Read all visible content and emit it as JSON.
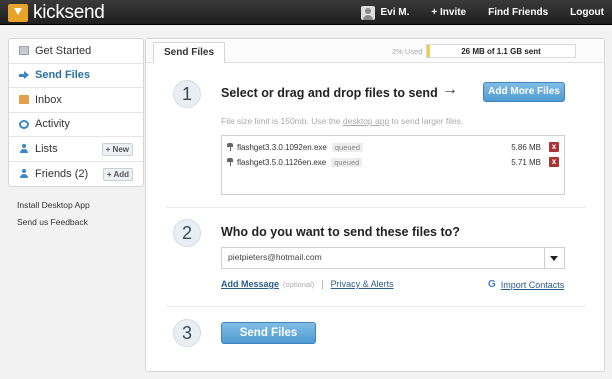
{
  "app": {
    "logo_text": "kicksend",
    "brand_color": "#e8a32a"
  },
  "nav": {
    "user": "Evi M.",
    "invite": "+ Invite",
    "find_friends": "Find Friends",
    "logout": "Logout"
  },
  "sidebar": {
    "items": [
      {
        "label": "Get Started",
        "icon": "get-started-icon"
      },
      {
        "label": "Send Files",
        "icon": "send-arrow-icon",
        "active": true
      },
      {
        "label": "Inbox",
        "icon": "inbox-icon"
      },
      {
        "label": "Activity",
        "icon": "activity-icon"
      },
      {
        "label": "Lists",
        "icon": "person-icon",
        "badge": "+ New"
      },
      {
        "label": "Friends (2)",
        "icon": "person-icon",
        "badge": "+ Add"
      }
    ],
    "links": [
      "Install Desktop App",
      "Send us Feedback"
    ]
  },
  "main": {
    "tab": "Send Files",
    "usage": {
      "percent_text": "2% Used",
      "text": "26 MB of 1.1 GB sent",
      "fraction": 0.02
    },
    "step1": {
      "number": "1",
      "title": "Select or drag and drop files to send",
      "arrow": "→",
      "add_more": "Add More Files",
      "limit_prefix": "File size limit is 150mb. Use the ",
      "limit_link": "desktop app",
      "limit_suffix": " to send larger files.",
      "files": [
        {
          "name": "flashget3.3.0.1092en.exe",
          "status": "queued",
          "size": "5.86 MB",
          "remove": "x"
        },
        {
          "name": "flashget3.5.0.1126en.exe",
          "status": "queued",
          "size": "5.71 MB",
          "remove": "x"
        }
      ]
    },
    "step2": {
      "number": "2",
      "title": "Who do you want to send these files to?",
      "email_value": "pietpieters@hotmail.com",
      "add_message": "Add Message",
      "optional": "(optional)",
      "separator": "|",
      "privacy": "Privacy & Alerts",
      "import_icon": "G",
      "import": "Import Contacts"
    },
    "step3": {
      "number": "3",
      "send": "Send Files"
    }
  }
}
